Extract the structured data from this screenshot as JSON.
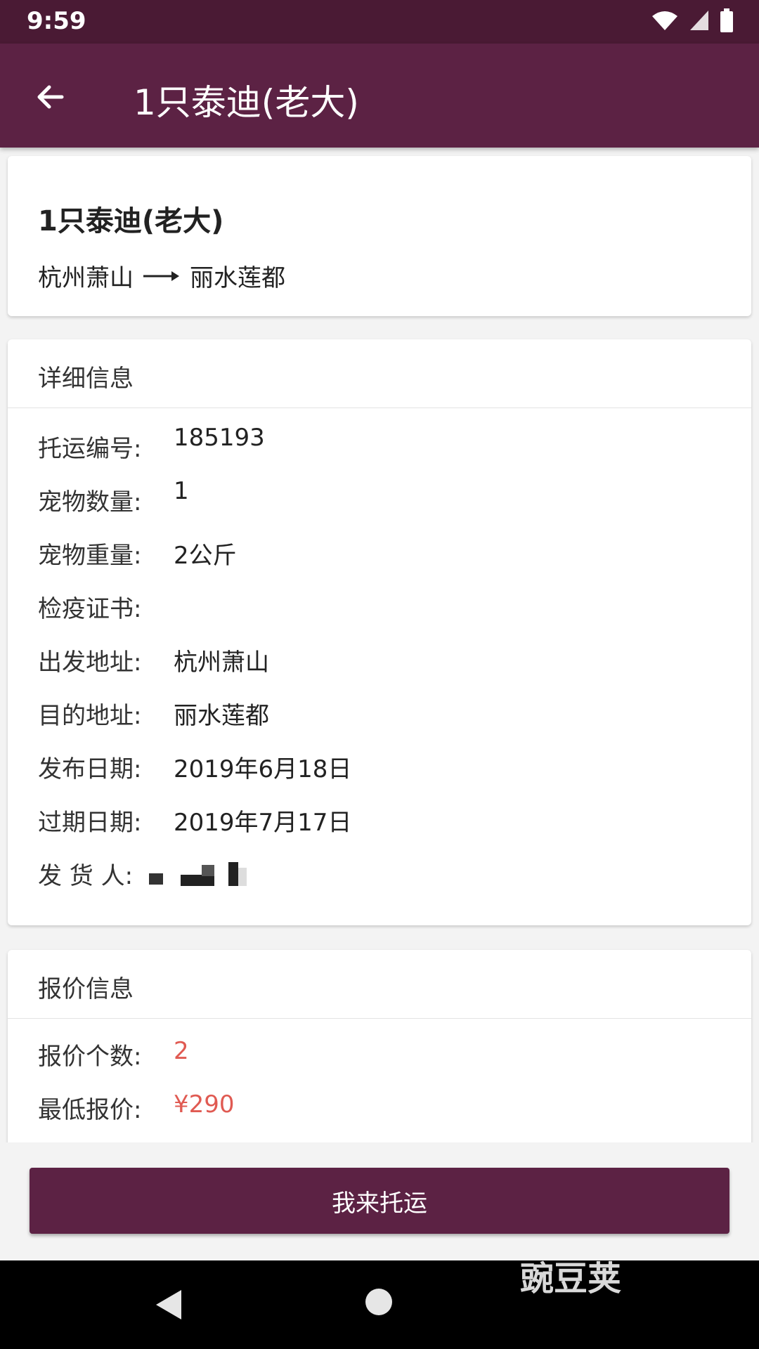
{
  "status_bar": {
    "time": "9:59"
  },
  "toolbar": {
    "title": "1只泰迪(老大)"
  },
  "summary": {
    "title": "1只泰迪(老大)",
    "from": "杭州萧山",
    "to": "丽水莲都"
  },
  "detail": {
    "header": "详细信息",
    "rows": [
      {
        "label": "托运编号:",
        "value": "185193"
      },
      {
        "label": "宠物数量:",
        "value": "1"
      },
      {
        "label": "宠物重量:",
        "value": "2公斤"
      },
      {
        "label": "检疫证书:",
        "value": ""
      },
      {
        "label": "出发地址:",
        "value": "杭州萧山"
      },
      {
        "label": "目的地址:",
        "value": "丽水莲都"
      },
      {
        "label": "发布日期:",
        "value": "2019年6月18日"
      },
      {
        "label": "过期日期:",
        "value": "2019年7月17日"
      },
      {
        "label": "发 货 人:",
        "value": ""
      }
    ]
  },
  "quote": {
    "header": "报价信息",
    "rows": [
      {
        "label": "报价个数:",
        "value": "2"
      },
      {
        "label": "最低报价:",
        "value": "¥290"
      }
    ]
  },
  "action": {
    "label": "我来托运"
  },
  "watermark": "豌豆荚",
  "colors": {
    "primary": "#5c2244",
    "status": "#4a1a34",
    "accent_red": "#e05a52"
  }
}
